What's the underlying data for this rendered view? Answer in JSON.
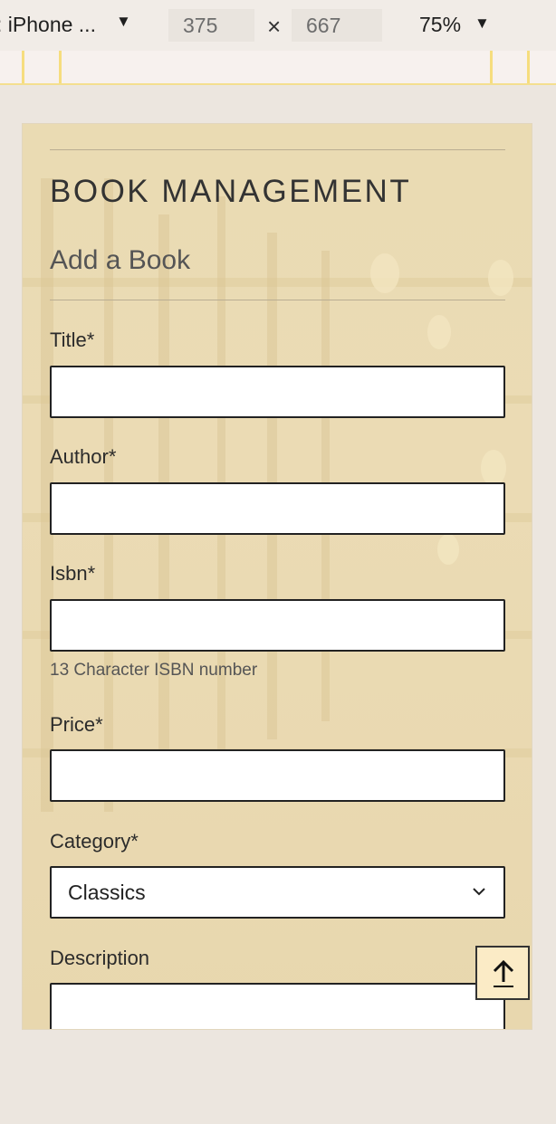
{
  "devtools": {
    "device": "iPhone ...",
    "width": "375",
    "height": "667",
    "zoom": "75%"
  },
  "page": {
    "heading": "BOOK MANAGEMENT",
    "subheading": "Add a Book",
    "fields": {
      "title_label": "Title*",
      "author_label": "Author*",
      "isbn_label": "Isbn*",
      "isbn_help": "13 Character ISBN number",
      "price_label": "Price*",
      "category_label": "Category*",
      "category_value": "Classics",
      "description_label": "Description"
    },
    "icons": {
      "back_to_top": "arrow-up-icon",
      "select_caret": "chevron-down-icon"
    }
  }
}
